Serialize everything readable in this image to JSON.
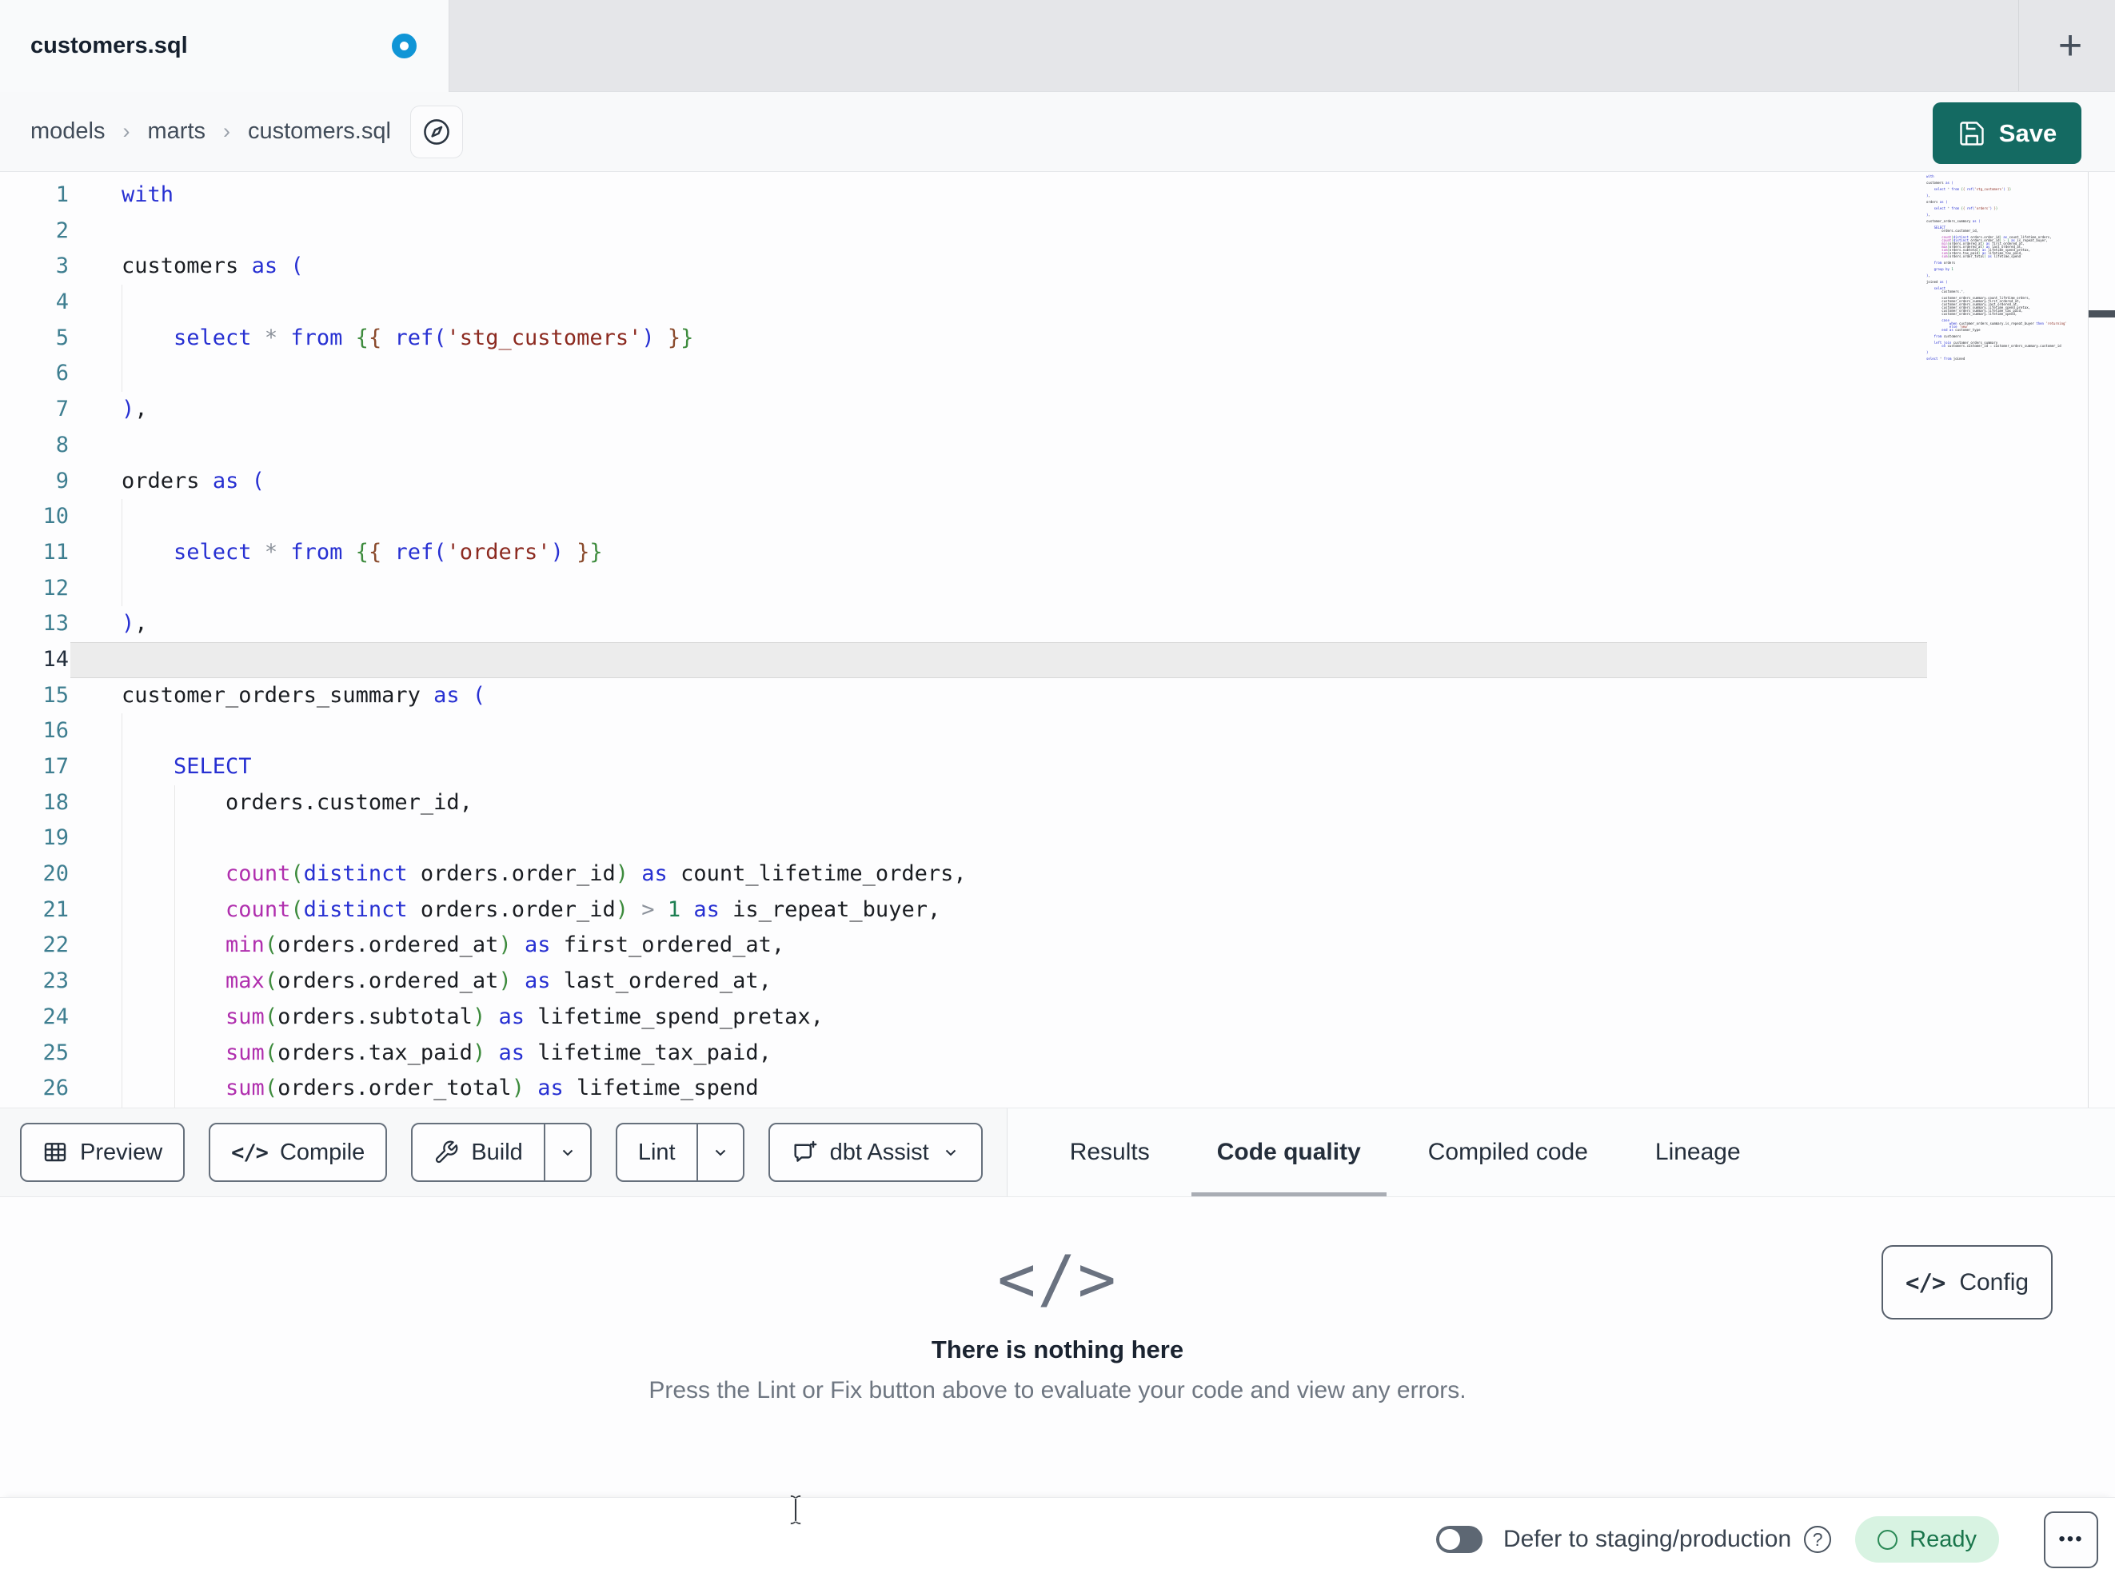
{
  "window": {
    "tab_title": "customers.sql",
    "new_tab_label": "+"
  },
  "breadcrumb": {
    "items": [
      "models",
      "marts",
      "customers.sql"
    ],
    "separator": "›"
  },
  "save_button": {
    "label": "Save"
  },
  "icons": {
    "save": "floppy-disk",
    "file_nav": "compass",
    "preview": "table-grid",
    "compile": "code-brackets",
    "build": "wrench",
    "assist": "chat-plus",
    "dropdown": "chevron-down",
    "help": "question-circle",
    "more": "ellipsis",
    "empty_state": "code-brackets",
    "status": "circle-outline",
    "unsaved": "blue-ring-dot",
    "new_tab": "plus",
    "mouse": "text-ibeam",
    "code_glyph": "</>",
    "help_glyph": "?",
    "ellipsis_glyph": "•••"
  },
  "editor": {
    "visible_lines": 26,
    "active_line": 14,
    "lines": [
      [
        [
          "with",
          "k"
        ]
      ],
      [],
      [
        [
          "customers",
          "t"
        ],
        [
          " ",
          "w"
        ],
        [
          "as",
          "k"
        ],
        [
          " ",
          "w"
        ],
        [
          "(",
          "b"
        ]
      ],
      [],
      [
        [
          "    ",
          "w"
        ],
        [
          "select",
          "k"
        ],
        [
          " ",
          "w"
        ],
        [
          "*",
          "o"
        ],
        [
          " ",
          "w"
        ],
        [
          "from",
          "k"
        ],
        [
          " ",
          "w"
        ],
        [
          "{",
          "g"
        ],
        [
          "{",
          "m"
        ],
        [
          " ",
          "w"
        ],
        [
          "ref",
          "k"
        ],
        [
          "(",
          "b"
        ],
        [
          "'stg_customers'",
          "s"
        ],
        [
          ")",
          "b"
        ],
        [
          " ",
          "w"
        ],
        [
          "}",
          "m"
        ],
        [
          "}",
          "g"
        ]
      ],
      [],
      [
        [
          ")",
          "b"
        ],
        [
          ",",
          "t"
        ]
      ],
      [],
      [
        [
          "orders",
          "t"
        ],
        [
          " ",
          "w"
        ],
        [
          "as",
          "k"
        ],
        [
          " ",
          "w"
        ],
        [
          "(",
          "b"
        ]
      ],
      [],
      [
        [
          "    ",
          "w"
        ],
        [
          "select",
          "k"
        ],
        [
          " ",
          "w"
        ],
        [
          "*",
          "o"
        ],
        [
          " ",
          "w"
        ],
        [
          "from",
          "k"
        ],
        [
          " ",
          "w"
        ],
        [
          "{",
          "g"
        ],
        [
          "{",
          "m"
        ],
        [
          " ",
          "w"
        ],
        [
          "ref",
          "k"
        ],
        [
          "(",
          "b"
        ],
        [
          "'orders'",
          "s"
        ],
        [
          ")",
          "b"
        ],
        [
          " ",
          "w"
        ],
        [
          "}",
          "m"
        ],
        [
          "}",
          "g"
        ]
      ],
      [],
      [
        [
          ")",
          "b"
        ],
        [
          ",",
          "t"
        ]
      ],
      [],
      [
        [
          "customer_orders_summary",
          "t"
        ],
        [
          " ",
          "w"
        ],
        [
          "as",
          "k"
        ],
        [
          " ",
          "w"
        ],
        [
          "(",
          "b"
        ]
      ],
      [],
      [
        [
          "    ",
          "w"
        ],
        [
          "SELECT",
          "k"
        ]
      ],
      [
        [
          "        ",
          "w"
        ],
        [
          "orders.customer_id,",
          "t"
        ]
      ],
      [],
      [
        [
          "        ",
          "w"
        ],
        [
          "count",
          "f"
        ],
        [
          "(",
          "g"
        ],
        [
          "distinct",
          "k"
        ],
        [
          " ",
          "w"
        ],
        [
          "orders.order_id",
          "t"
        ],
        [
          ")",
          "g"
        ],
        [
          " ",
          "w"
        ],
        [
          "as",
          "k"
        ],
        [
          " ",
          "w"
        ],
        [
          "count_lifetime_orders,",
          "t"
        ]
      ],
      [
        [
          "        ",
          "w"
        ],
        [
          "count",
          "f"
        ],
        [
          "(",
          "g"
        ],
        [
          "distinct",
          "k"
        ],
        [
          " ",
          "w"
        ],
        [
          "orders.order_id",
          "t"
        ],
        [
          ")",
          "g"
        ],
        [
          " ",
          "w"
        ],
        [
          ">",
          "o"
        ],
        [
          " ",
          "w"
        ],
        [
          "1",
          "n"
        ],
        [
          " ",
          "w"
        ],
        [
          "as",
          "k"
        ],
        [
          " ",
          "w"
        ],
        [
          "is_repeat_buyer,",
          "t"
        ]
      ],
      [
        [
          "        ",
          "w"
        ],
        [
          "min",
          "f"
        ],
        [
          "(",
          "g"
        ],
        [
          "orders.ordered_at",
          "t"
        ],
        [
          ")",
          "g"
        ],
        [
          " ",
          "w"
        ],
        [
          "as",
          "k"
        ],
        [
          " ",
          "w"
        ],
        [
          "first_ordered_at,",
          "t"
        ]
      ],
      [
        [
          "        ",
          "w"
        ],
        [
          "max",
          "f"
        ],
        [
          "(",
          "g"
        ],
        [
          "orders.ordered_at",
          "t"
        ],
        [
          ")",
          "g"
        ],
        [
          " ",
          "w"
        ],
        [
          "as",
          "k"
        ],
        [
          " ",
          "w"
        ],
        [
          "last_ordered_at,",
          "t"
        ]
      ],
      [
        [
          "        ",
          "w"
        ],
        [
          "sum",
          "f"
        ],
        [
          "(",
          "g"
        ],
        [
          "orders.subtotal",
          "t"
        ],
        [
          ")",
          "g"
        ],
        [
          " ",
          "w"
        ],
        [
          "as",
          "k"
        ],
        [
          " ",
          "w"
        ],
        [
          "lifetime_spend_pretax,",
          "t"
        ]
      ],
      [
        [
          "        ",
          "w"
        ],
        [
          "sum",
          "f"
        ],
        [
          "(",
          "g"
        ],
        [
          "orders.tax_paid",
          "t"
        ],
        [
          ")",
          "g"
        ],
        [
          " ",
          "w"
        ],
        [
          "as",
          "k"
        ],
        [
          " ",
          "w"
        ],
        [
          "lifetime_tax_paid,",
          "t"
        ]
      ],
      [
        [
          "        ",
          "w"
        ],
        [
          "sum",
          "f"
        ],
        [
          "(",
          "g"
        ],
        [
          "orders.order_total",
          "t"
        ],
        [
          ")",
          "g"
        ],
        [
          " ",
          "w"
        ],
        [
          "as",
          "k"
        ],
        [
          " ",
          "w"
        ],
        [
          "lifetime_spend",
          "t"
        ]
      ],
      [],
      [
        [
          "    ",
          "w"
        ],
        [
          "from",
          "k"
        ],
        [
          " ",
          "w"
        ],
        [
          "orders",
          "t"
        ]
      ],
      [],
      [
        [
          "    ",
          "w"
        ],
        [
          "group by",
          "k"
        ],
        [
          " ",
          "w"
        ],
        [
          "1",
          "n"
        ]
      ],
      [],
      [
        [
          ")",
          "b"
        ],
        [
          ",",
          "t"
        ]
      ],
      [],
      [
        [
          "joined",
          "t"
        ],
        [
          " ",
          "w"
        ],
        [
          "as",
          "k"
        ],
        [
          " ",
          "w"
        ],
        [
          "(",
          "b"
        ]
      ],
      [],
      [
        [
          "    ",
          "w"
        ],
        [
          "select",
          "k"
        ]
      ],
      [
        [
          "        ",
          "w"
        ],
        [
          "customers.",
          "t"
        ],
        [
          "*,",
          "o"
        ]
      ],
      [],
      [
        [
          "        ",
          "w"
        ],
        [
          "customer_orders_summary.count_lifetime_orders,",
          "t"
        ]
      ],
      [
        [
          "        ",
          "w"
        ],
        [
          "customer_orders_summary.first_ordered_at,",
          "t"
        ]
      ],
      [
        [
          "        ",
          "w"
        ],
        [
          "customer_orders_summary.last_ordered_at,",
          "t"
        ]
      ],
      [
        [
          "        ",
          "w"
        ],
        [
          "customer_orders_summary.lifetime_spend_pretax,",
          "t"
        ]
      ],
      [
        [
          "        ",
          "w"
        ],
        [
          "customer_orders_summary.lifetime_tax_paid,",
          "t"
        ]
      ],
      [
        [
          "        ",
          "w"
        ],
        [
          "customer_orders_summary.lifetime_spend,",
          "t"
        ]
      ],
      [],
      [
        [
          "        ",
          "w"
        ],
        [
          "case",
          "k"
        ]
      ],
      [
        [
          "            ",
          "w"
        ],
        [
          "when",
          "k"
        ],
        [
          " ",
          "w"
        ],
        [
          "customer_orders_summary.is_repeat_buyer",
          "t"
        ],
        [
          " ",
          "w"
        ],
        [
          "then",
          "k"
        ],
        [
          " ",
          "w"
        ],
        [
          "'returning'",
          "s"
        ]
      ],
      [
        [
          "            ",
          "w"
        ],
        [
          "else",
          "k"
        ],
        [
          " ",
          "w"
        ],
        [
          "'new'",
          "s"
        ]
      ],
      [
        [
          "        ",
          "w"
        ],
        [
          "end",
          "k"
        ],
        [
          " ",
          "w"
        ],
        [
          "as",
          "k"
        ],
        [
          " ",
          "w"
        ],
        [
          "customer_type",
          "t"
        ]
      ],
      [],
      [
        [
          "    ",
          "w"
        ],
        [
          "from",
          "k"
        ],
        [
          " ",
          "w"
        ],
        [
          "customers",
          "t"
        ]
      ],
      [],
      [
        [
          "    ",
          "w"
        ],
        [
          "left join",
          "k"
        ],
        [
          " ",
          "w"
        ],
        [
          "customer_orders_summary",
          "t"
        ]
      ],
      [
        [
          "        ",
          "w"
        ],
        [
          "on",
          "k"
        ],
        [
          " ",
          "w"
        ],
        [
          "customers.customer_id",
          "t"
        ],
        [
          " ",
          "w"
        ],
        [
          "=",
          "o"
        ],
        [
          " ",
          "w"
        ],
        [
          "customer_orders_summary.customer_id",
          "t"
        ]
      ],
      [],
      [
        [
          ")",
          "b"
        ]
      ],
      [],
      [
        [
          "select",
          "k"
        ],
        [
          " ",
          "w"
        ],
        [
          "*",
          "o"
        ],
        [
          " ",
          "w"
        ],
        [
          "from",
          "k"
        ],
        [
          " ",
          "w"
        ],
        [
          "joined",
          "t"
        ]
      ]
    ]
  },
  "toolbar": {
    "preview_label": "Preview",
    "compile_label": "Compile",
    "build_label": "Build",
    "lint_label": "Lint",
    "assist_label": "dbt Assist"
  },
  "result_tabs": {
    "items": [
      "Results",
      "Code quality",
      "Compiled code",
      "Lineage"
    ],
    "active": "Code quality"
  },
  "panel": {
    "title": "There is nothing here",
    "subtitle": "Press the Lint or Fix button above to evaluate your code and view any errors.",
    "config_label": "Config"
  },
  "statusbar": {
    "defer_label": "Defer to staging/production",
    "ready_label": "Ready"
  },
  "colors": {
    "accent_teal": "#146a62",
    "unsaved_dot_blue": "#1095d6",
    "ready_bg": "#d8f3e2",
    "ready_text": "#19754b",
    "active_tab_underline": "#a9adb4",
    "keyword_blue": "#2730d2",
    "function_magenta": "#b02fae",
    "string_red": "#8c2a20",
    "bracket_green": "#3d8b3d",
    "line_number_teal": "#3e7e90"
  }
}
